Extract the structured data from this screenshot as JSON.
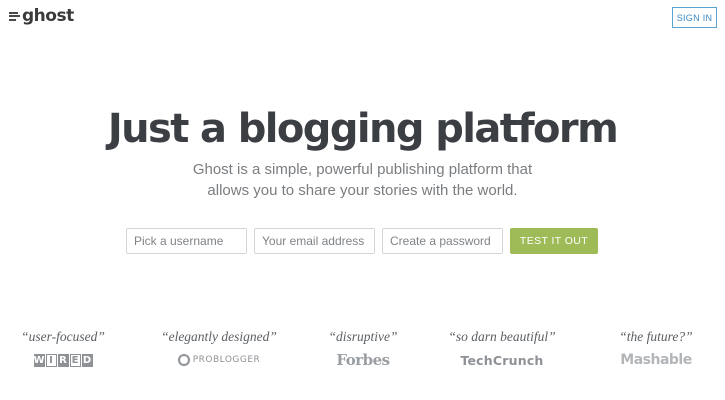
{
  "header": {
    "logo_text": "ghost",
    "signin_label": "SIGN IN"
  },
  "hero": {
    "title": "Just a blogging platform",
    "subtitle": "Ghost is a simple, powerful publishing platform that allows you to share your stories with the world."
  },
  "signup": {
    "username_placeholder": "Pick a username",
    "email_placeholder": "Your email address",
    "password_placeholder": "Create a password",
    "submit_label": "TEST IT OUT"
  },
  "press": [
    {
      "quote": "“user-focused”",
      "brand": "WIRED",
      "icon": "wired-logo"
    },
    {
      "quote": "“elegantly designed”",
      "brand": "PROBLOGGER",
      "icon": "problogger-logo"
    },
    {
      "quote": "“disruptive”",
      "brand": "Forbes",
      "icon": "forbes-logo"
    },
    {
      "quote": "“so darn beautiful”",
      "brand": "TechCrunch",
      "icon": "techcrunch-logo"
    },
    {
      "quote": "“the future?”",
      "brand": "Mashable",
      "icon": "mashable-logo"
    }
  ],
  "colors": {
    "accent_green": "#9fbb58",
    "signin_blue": "#3c8ac7",
    "title_text": "#3b3e43"
  }
}
